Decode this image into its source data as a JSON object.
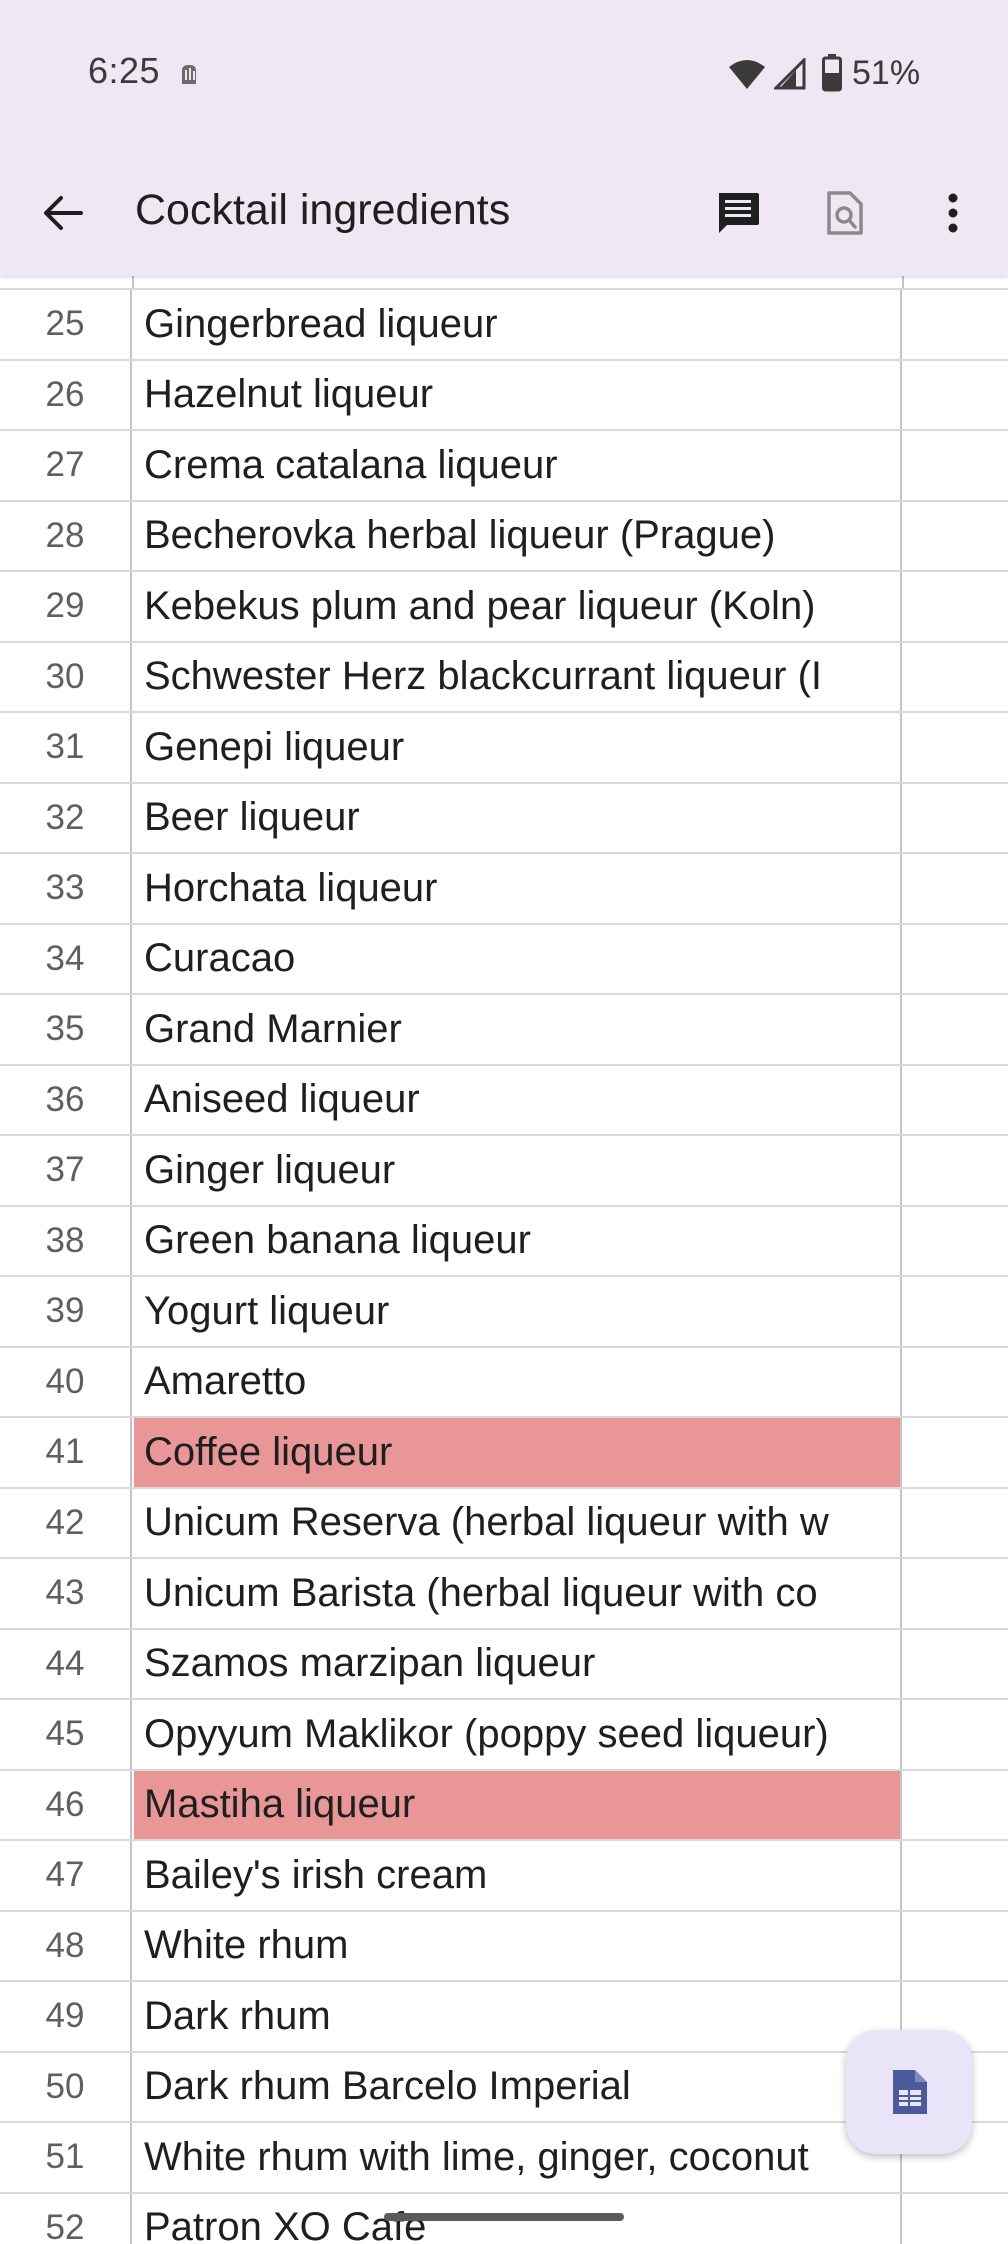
{
  "status_bar": {
    "time": "6:25",
    "battery": "51%",
    "icons": [
      "notification-icon",
      "wifi-icon",
      "signal-icon",
      "battery-icon"
    ]
  },
  "app_bar": {
    "title": "Cocktail ingredients",
    "icons": {
      "back": "arrow-back-icon",
      "comments": "comment-icon",
      "preview": "document-preview-icon",
      "more": "more-vert-icon"
    }
  },
  "colors": {
    "app_bar_bg": "#efe8f4",
    "highlight": "#e99697",
    "fab_bg": "#eae4f8",
    "fab_icon": "#4a5a9a"
  },
  "sheet": {
    "rows": [
      {
        "num": "25",
        "value": "Gingerbread liqueur",
        "highlight": false
      },
      {
        "num": "26",
        "value": "Hazelnut liqueur",
        "highlight": false
      },
      {
        "num": "27",
        "value": "Crema catalana liqueur",
        "highlight": false
      },
      {
        "num": "28",
        "value": "Becherovka herbal liqueur (Prague)",
        "highlight": false
      },
      {
        "num": "29",
        "value": "Kebekus plum and pear liqueur (Koln)",
        "highlight": false
      },
      {
        "num": "30",
        "value": "Schwester Herz blackcurrant liqueur (I",
        "highlight": false
      },
      {
        "num": "31",
        "value": "Genepi liqueur",
        "highlight": false
      },
      {
        "num": "32",
        "value": "Beer liqueur",
        "highlight": false
      },
      {
        "num": "33",
        "value": "Horchata liqueur",
        "highlight": false
      },
      {
        "num": "34",
        "value": "Curacao",
        "highlight": false
      },
      {
        "num": "35",
        "value": "Grand Marnier",
        "highlight": false
      },
      {
        "num": "36",
        "value": "Aniseed liqueur",
        "highlight": false
      },
      {
        "num": "37",
        "value": "Ginger liqueur",
        "highlight": false
      },
      {
        "num": "38",
        "value": "Green banana liqueur",
        "highlight": false
      },
      {
        "num": "39",
        "value": "Yogurt liqueur",
        "highlight": false
      },
      {
        "num": "40",
        "value": "Amaretto",
        "highlight": false
      },
      {
        "num": "41",
        "value": "Coffee liqueur",
        "highlight": true
      },
      {
        "num": "42",
        "value": "Unicum Reserva (herbal liqueur with w",
        "highlight": false
      },
      {
        "num": "43",
        "value": "Unicum Barista (herbal liqueur with co",
        "highlight": false
      },
      {
        "num": "44",
        "value": "Szamos marzipan liqueur",
        "highlight": false
      },
      {
        "num": "45",
        "value": "Opyyum Maklikor (poppy seed liqueur)",
        "highlight": false
      },
      {
        "num": "46",
        "value": "Mastiha liqueur",
        "highlight": true
      },
      {
        "num": "47",
        "value": "Bailey's irish cream",
        "highlight": false
      },
      {
        "num": "48",
        "value": "White rhum",
        "highlight": false
      },
      {
        "num": "49",
        "value": "Dark rhum",
        "highlight": false
      },
      {
        "num": "50",
        "value": "Dark rhum Barcelo Imperial",
        "highlight": false
      },
      {
        "num": "51",
        "value": "White rhum with lime, ginger, coconut",
        "highlight": false
      },
      {
        "num": "52",
        "value": "Patron XO Cafe",
        "highlight": false
      }
    ]
  },
  "fab": {
    "icon": "sheets-table-icon"
  }
}
